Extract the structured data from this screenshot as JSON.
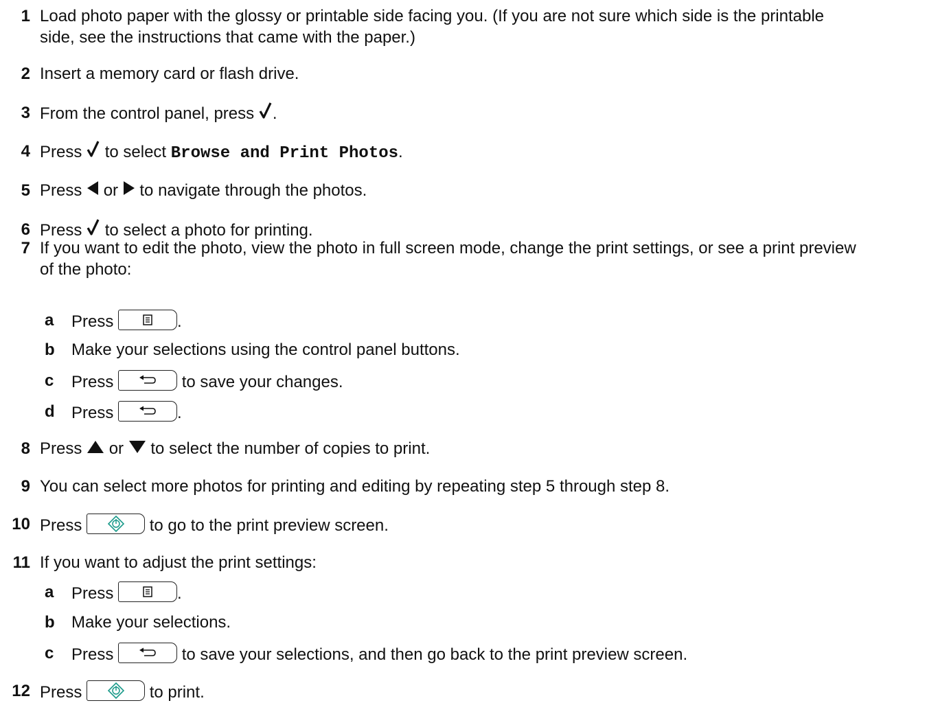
{
  "steps": [
    {
      "num": "1",
      "line1": "Load photo paper with the glossy or printable side facing you. (If you are not sure which side is the printable",
      "line2": "side, see the instructions that came with the paper.)"
    },
    {
      "num": "2",
      "text": "Insert a memory card or flash drive."
    },
    {
      "num": "3",
      "pre": "From the control panel, press",
      "post": "."
    },
    {
      "num": "4",
      "pre": "Press",
      "mid": "to select",
      "code": "Browse and Print Photos",
      "post": "."
    },
    {
      "num": "5",
      "pre": "Press",
      "or": "or",
      "post": "to navigate through the photos."
    },
    {
      "num": "6",
      "pre": "Press",
      "post": "to select a photo for printing."
    },
    {
      "num": "7",
      "line1": "If you want to edit the photo, view the photo in full screen mode, change the print settings, or see a print preview",
      "line2": "of the photo:",
      "subs": [
        {
          "letter": "a",
          "pre": "Press",
          "post": "."
        },
        {
          "letter": "b",
          "text": "Make your selections using the control panel buttons."
        },
        {
          "letter": "c",
          "pre": "Press",
          "post": "to save your changes."
        },
        {
          "letter": "d",
          "pre": "Press",
          "post": "."
        }
      ]
    },
    {
      "num": "8",
      "pre": "Press",
      "or": "or",
      "post": "to select the number of copies to print."
    },
    {
      "num": "9",
      "text": "You can select more photos for printing and editing by repeating step 5 through step 8."
    },
    {
      "num": "10",
      "pre": "Press",
      "post": "to go to the print preview screen."
    },
    {
      "num": "11",
      "text": "If you want to adjust the print settings:",
      "subs": [
        {
          "letter": "a",
          "pre": "Press",
          "post": "."
        },
        {
          "letter": "b",
          "text": "Make your selections."
        },
        {
          "letter": "c",
          "pre": "Press",
          "post": "to save your selections, and then go back to the print preview screen."
        }
      ]
    },
    {
      "num": "12",
      "pre": "Press",
      "post": "to print."
    }
  ],
  "icons": {
    "select": "checkmark-icon",
    "left": "left-arrow-icon",
    "right": "right-arrow-icon",
    "up": "up-arrow-icon",
    "down": "down-arrow-icon",
    "menu": "menu-button-icon",
    "back": "back-button-icon",
    "start": "start-button-icon"
  }
}
